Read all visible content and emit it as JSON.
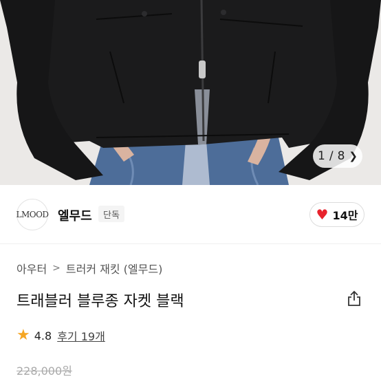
{
  "gallery": {
    "current": "1",
    "separator": "/",
    "total": "8"
  },
  "brand": {
    "logo_text": "LMOOD",
    "name": "엘무드",
    "badge": "단독"
  },
  "like": {
    "count": "14만"
  },
  "breadcrumb": {
    "items": [
      "아우터",
      "트러커 재킷 (엘무드)"
    ]
  },
  "product": {
    "title": "트래블러 블루종 자켓 블랙",
    "rating": "4.8",
    "reviews_label": "후기 19개",
    "original_price": "228,000원"
  },
  "colors": {
    "jacket": "#1b1b1c",
    "denim": "#4d6d99",
    "heart": "#e8222c",
    "star": "#f5a623"
  }
}
